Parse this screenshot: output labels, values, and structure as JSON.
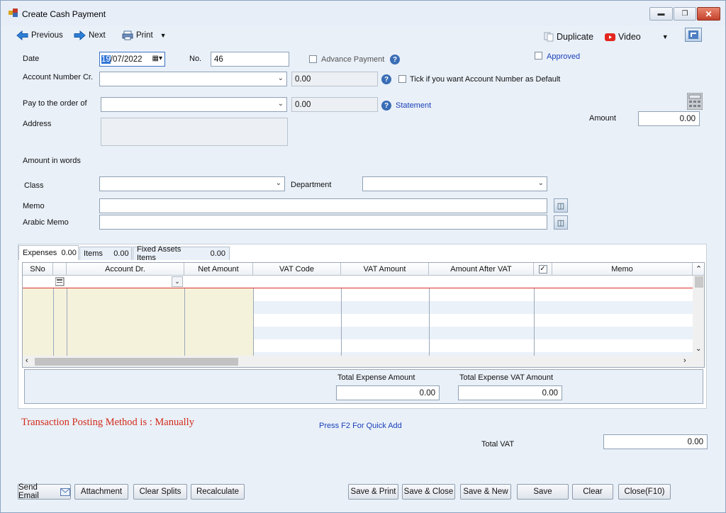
{
  "window": {
    "title": "Create Cash Payment"
  },
  "toolbar": {
    "previous": "Previous",
    "next": "Next",
    "print": "Print",
    "duplicate": "Duplicate",
    "video": "Video"
  },
  "form": {
    "date_label": "Date",
    "date_value_sel": "19",
    "date_value_rest": "/07/2022",
    "no_label": "No.",
    "no_value": "46",
    "advance_payment": "Advance Payment",
    "approved": "Approved",
    "account_cr_label": "Account Number Cr.",
    "account_cr_balance": "0.00",
    "tick_default": "Tick if you want Account Number as Default",
    "pay_to_label": "Pay to the order of",
    "pay_to_balance": "0.00",
    "statement": "Statement",
    "amount_label": "Amount",
    "amount_value": "0.00",
    "address_label": "Address",
    "amount_words_label": "Amount in words",
    "class_label": "Class",
    "department_label": "Department",
    "memo_label": "Memo",
    "arabic_memo_label": "Arabic Memo"
  },
  "tabs": [
    {
      "label": "Expenses",
      "value": "0.00"
    },
    {
      "label": "Items",
      "value": "0.00"
    },
    {
      "label": "Fixed Assets Items",
      "value": "0.00"
    }
  ],
  "grid": {
    "columns": [
      "SNo",
      "Account Dr.",
      "Net Amount",
      "VAT Code",
      "VAT Amount",
      "Amount After VAT",
      "Memo"
    ]
  },
  "totals": {
    "total_expense_label": "Total Expense Amount",
    "total_expense_value": "0.00",
    "total_expense_vat_label": "Total Expense VAT Amount",
    "total_expense_vat_value": "0.00",
    "total_vat_label": "Total VAT",
    "total_vat_value": "0.00"
  },
  "status": {
    "posting_method": "Transaction Posting Method is : Manually",
    "quick_add": "Press F2 For Quick Add"
  },
  "buttons": {
    "send_email": "Send Email",
    "attachment": "Attachment",
    "clear_splits": "Clear Splits",
    "recalculate": "Recalculate",
    "save_print": "Save & Print",
    "save_close": "Save & Close",
    "save_new": "Save & New",
    "save": "Save",
    "clear": "Clear",
    "close": "Close(F10)"
  },
  "colors": {
    "posting_text": "#d42a1a",
    "link": "#1a3fb8",
    "grid_left_bg": "#f5f2dc",
    "grid_red_line": "#d9332a"
  }
}
